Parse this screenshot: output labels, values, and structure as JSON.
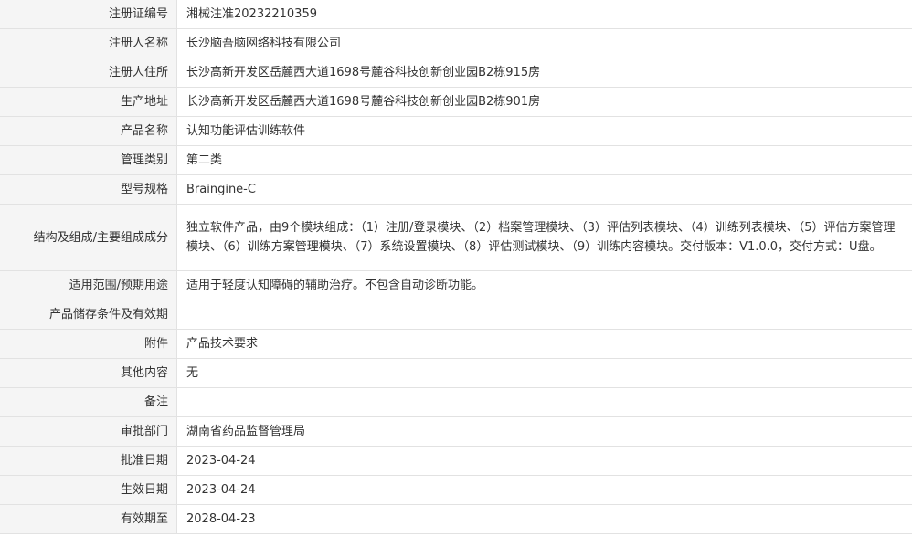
{
  "rows": [
    {
      "label": "注册证编号",
      "value": "湘械注准20232210359"
    },
    {
      "label": "注册人名称",
      "value": "长沙脑吾脑网络科技有限公司"
    },
    {
      "label": "注册人住所",
      "value": "长沙高新开发区岳麓西大道1698号麓谷科技创新创业园B2栋915房"
    },
    {
      "label": "生产地址",
      "value": "长沙高新开发区岳麓西大道1698号麓谷科技创新创业园B2栋901房"
    },
    {
      "label": "产品名称",
      "value": "认知功能评估训练软件"
    },
    {
      "label": "管理类别",
      "value": "第二类"
    },
    {
      "label": "型号规格",
      "value": "Braingine-C"
    },
    {
      "label": "结构及组成/主要组成成分",
      "value": "独立软件产品，由9个模块组成：（1）注册/登录模块、（2）档案管理模块、（3）评估列表模块、（4）训练列表模块、（5）评估方案管理模块、（6）训练方案管理模块、（7）系统设置模块、（8）评估测试模块、（9）训练内容模块。交付版本：V1.0.0，交付方式：U盘。"
    },
    {
      "label": "适用范围/预期用途",
      "value": "适用于轻度认知障碍的辅助治疗。不包含自动诊断功能。"
    },
    {
      "label": "产品储存条件及有效期",
      "value": ""
    },
    {
      "label": "附件",
      "value": "产品技术要求"
    },
    {
      "label": "其他内容",
      "value": "无"
    },
    {
      "label": "备注",
      "value": ""
    },
    {
      "label": "审批部门",
      "value": "湖南省药品监督管理局"
    },
    {
      "label": "批准日期",
      "value": "2023-04-24"
    },
    {
      "label": "生效日期",
      "value": "2023-04-24"
    },
    {
      "label": "有效期至",
      "value": "2028-04-23"
    }
  ]
}
